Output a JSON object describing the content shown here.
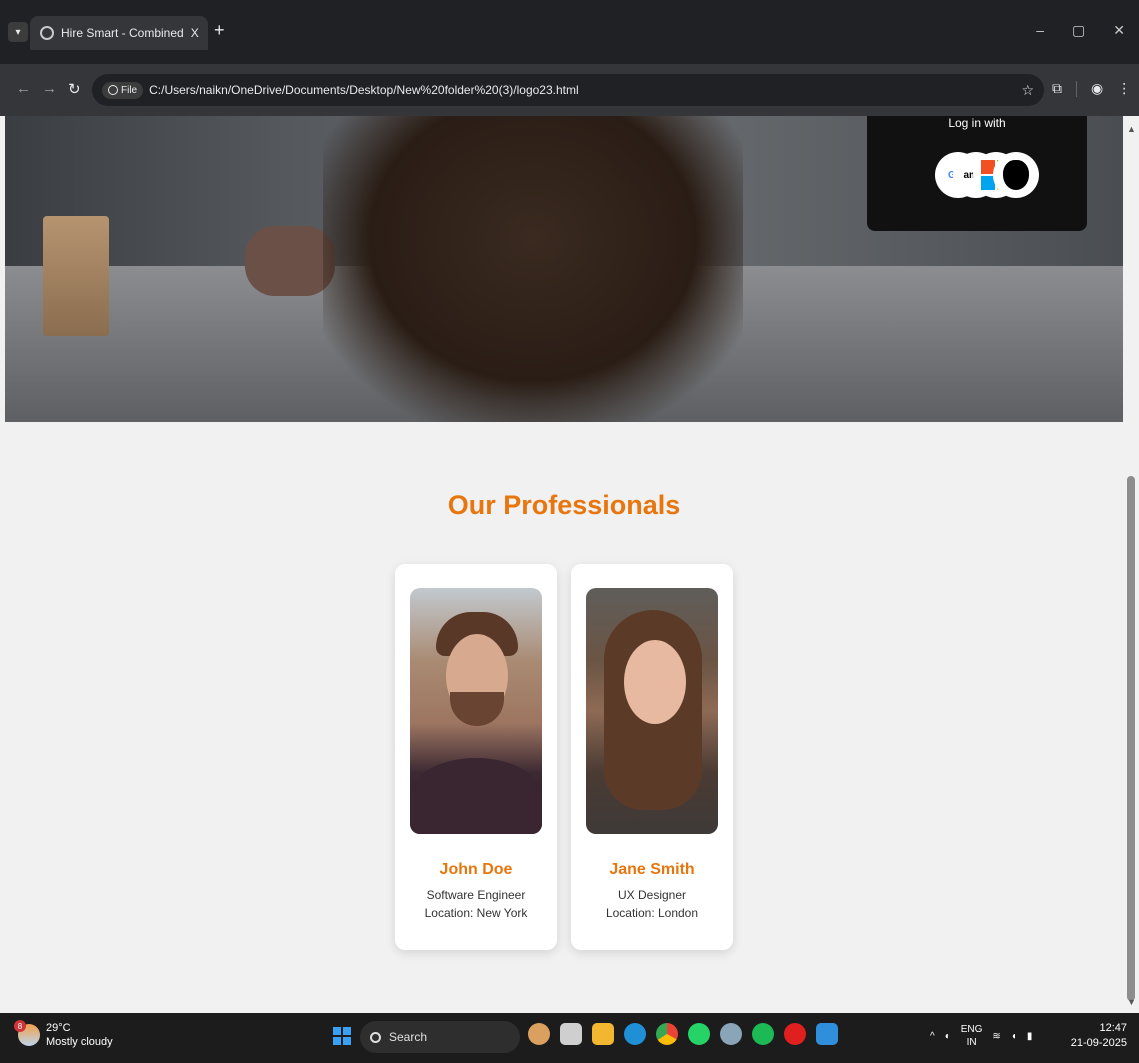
{
  "browser": {
    "tab_title": "Hire Smart - Combined",
    "tab_close": "X",
    "new_tab": "+",
    "file_chip": "File",
    "url": "C:/Users/naikn/OneDrive/Documents/Desktop/New%20folder%20(3)/logo23.html"
  },
  "hero": {
    "login_text": "Log in with",
    "providers": [
      "Google",
      "amazon",
      "Microsoft",
      "Apple"
    ],
    "google_partial": "Goo",
    "amazon_partial": "amaz"
  },
  "section": {
    "title": "Our Professionals"
  },
  "professionals": [
    {
      "name": "John Doe",
      "role": "Software Engineer",
      "location": "Location: New York"
    },
    {
      "name": "Jane Smith",
      "role": "UX Designer",
      "location": "Location: London"
    }
  ],
  "taskbar": {
    "weather_badge": "8",
    "temperature": "29°C",
    "condition": "Mostly cloudy",
    "search_label": "Search",
    "lang_top": "ENG",
    "lang_bottom": "IN",
    "time": "12:47",
    "date": "21-09-2025"
  },
  "colors": {
    "accent": "#e8760e",
    "chrome_dark": "#202124",
    "page_bg": "#f1f1f1"
  }
}
